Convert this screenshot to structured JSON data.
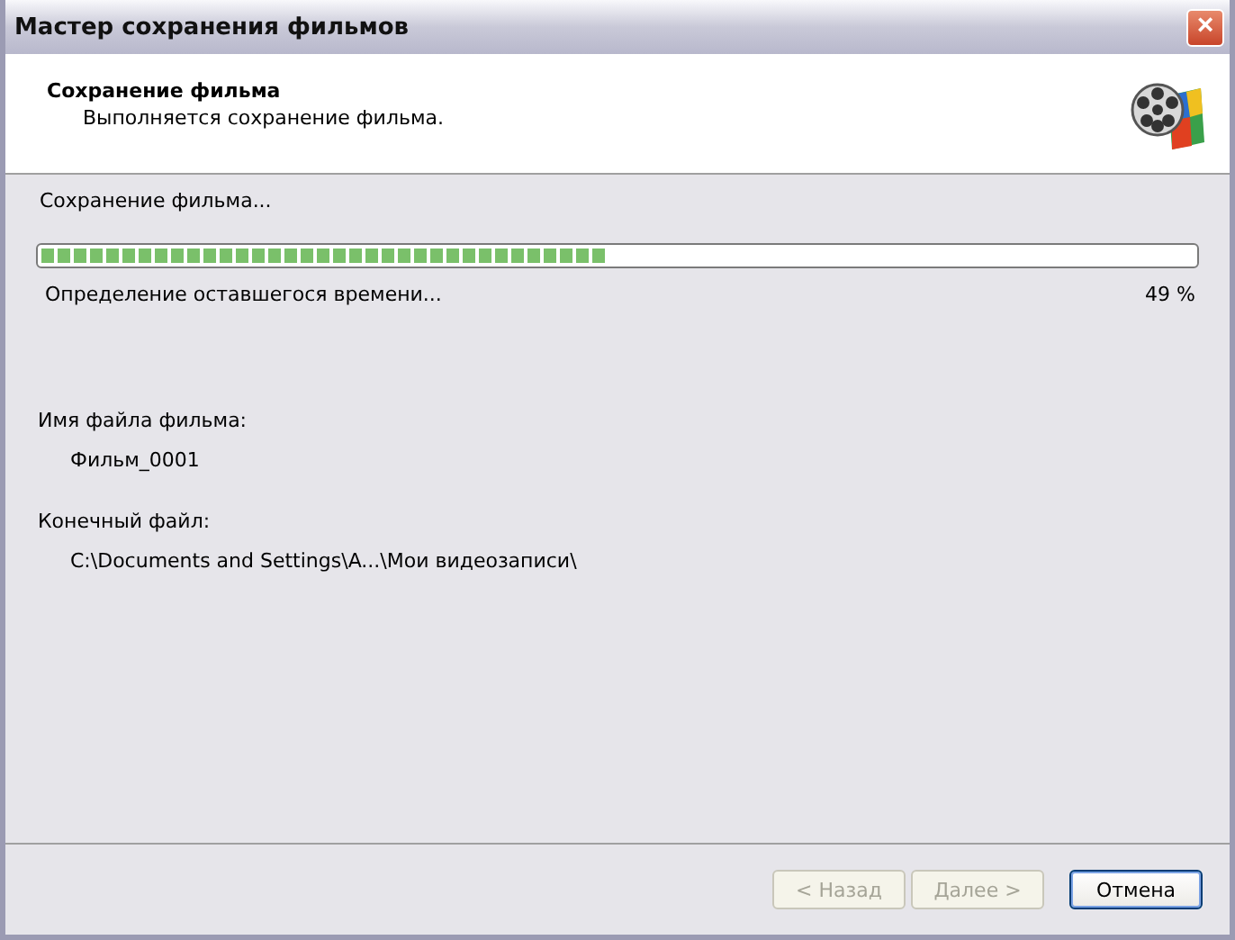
{
  "window": {
    "title": "Мастер сохранения фильмов",
    "close": "×"
  },
  "header": {
    "title": "Сохранение фильма",
    "subtitle": "Выполняется сохранение фильма."
  },
  "status": "Сохранение фильма...",
  "progress": {
    "level": 0.49,
    "caption": "Определение оставшегося времени...",
    "reading": "49 %"
  },
  "fields": [
    {
      "label": "Имя файла фильма:",
      "value": "Фильм_0001"
    },
    {
      "label": "Конечный файл:",
      "value": "C:\\Documents and Settings\\A...\\Мои видеозаписи\\"
    }
  ],
  "buttons": [
    {
      "label": "< Назад",
      "disabled": true,
      "default": false
    },
    {
      "label": "Далее >",
      "disabled": true,
      "default": false
    },
    {
      "label": "Отмена",
      "disabled": false,
      "default": true
    }
  ]
}
